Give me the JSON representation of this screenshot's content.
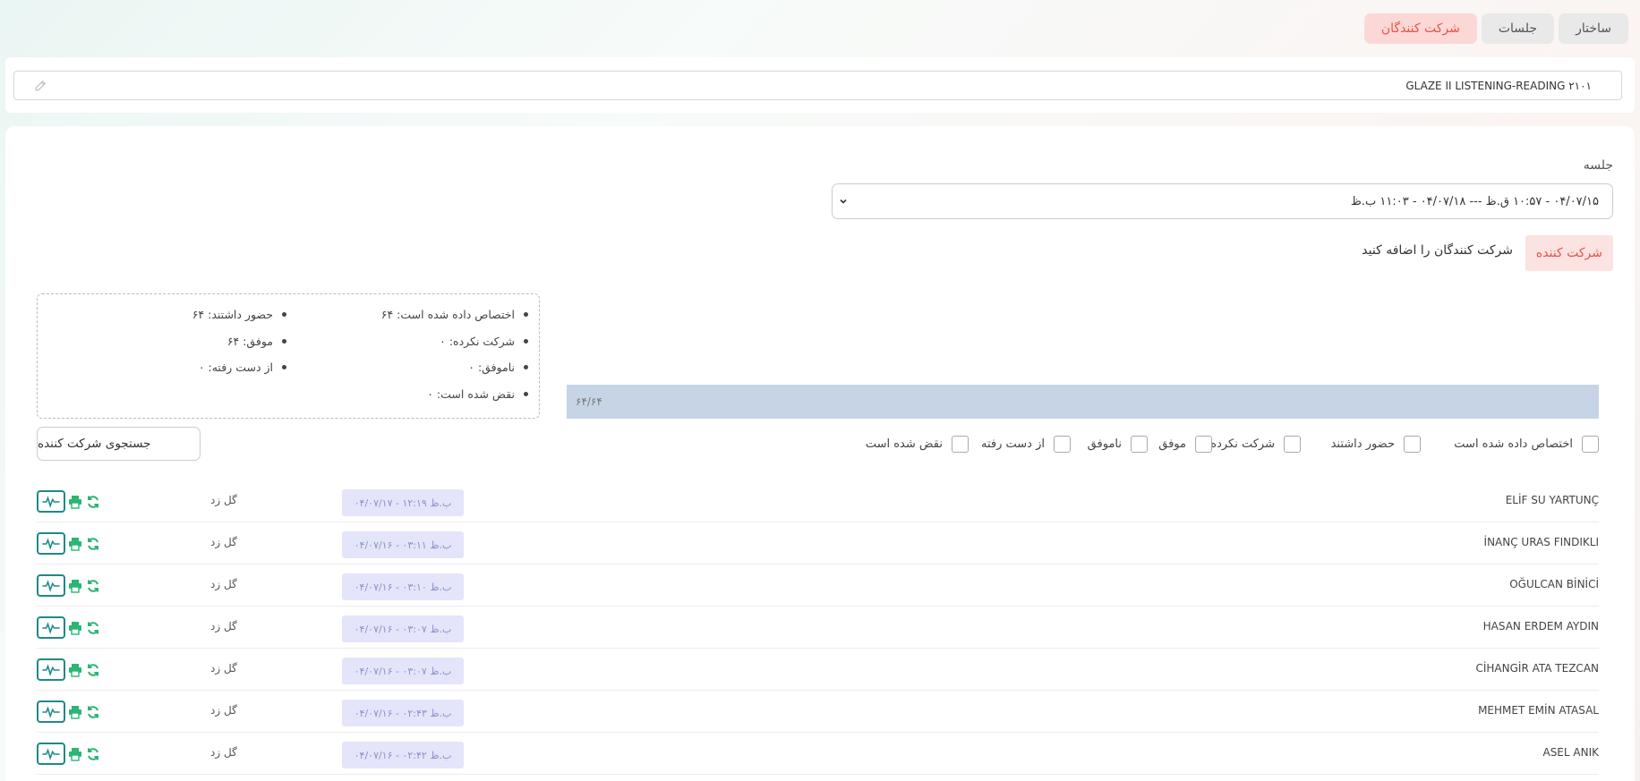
{
  "tabs": [
    {
      "label": "ساختار",
      "active": false
    },
    {
      "label": "جلسات",
      "active": false
    },
    {
      "label": "شرکت کنندگان",
      "active": true
    }
  ],
  "course_title": "GLAZE II LISTENING-READING ۲۱۰۱",
  "session": {
    "label": "جلسه",
    "selected": "۰۴/۰۷/۱۵ - ۱۰:۵۷ ق.ظ --- ۰۴/۰۷/۱۸ - ۱۱:۰۳ ب.ظ"
  },
  "participant_tab": "شرکت کننده",
  "add_text": "شرکت کنندگان را اضافه کنید",
  "stats": {
    "assigned": "اختصاص داده شده است: ۶۴",
    "attended": "حضور داشتند: ۶۴",
    "not_attended": "شرکت نکرده: ۰",
    "passed": "موفق: ۶۴",
    "failed": "ناموفق: ۰",
    "lost": "از دست رفته: ۰",
    "violated": "نقض شده است: ۰"
  },
  "progress": {
    "text": "۶۴/۶۴",
    "fraction": 1.0
  },
  "search_label": "جستجوی شرکت کننده",
  "filters": [
    "اختصاص داده شده است",
    "حضور داشتند",
    "شرکت نکرده",
    "موفق",
    "ناموفق",
    "از دست رفته",
    "نقض شده است"
  ],
  "rows": [
    {
      "name": "ELİF SU YARTUNÇ",
      "timestamp": "۰۴/۰۷/۱۷ - ۱۲:۱۹ ب.ظ",
      "status": "گل زد"
    },
    {
      "name": "İNANÇ URAS FINDIKLI",
      "timestamp": "۰۴/۰۷/۱۶ - ۰۳:۱۱ ب.ظ",
      "status": "گل زد"
    },
    {
      "name": "OĞULCAN BİNİCİ",
      "timestamp": "۰۴/۰۷/۱۶ - ۰۳:۱۰ ب.ظ",
      "status": "گل زد"
    },
    {
      "name": "HASAN ERDEM AYDIN",
      "timestamp": "۰۴/۰۷/۱۶ - ۰۳:۰۷ ب.ظ",
      "status": "گل زد"
    },
    {
      "name": "CİHANGİR ATA TEZCAN",
      "timestamp": "۰۴/۰۷/۱۶ - ۰۳:۰۷ ب.ظ",
      "status": "گل زد"
    },
    {
      "name": "MEHMET EMİN ATASAL",
      "timestamp": "۰۴/۰۷/۱۶ - ۰۲:۴۳ ب.ظ",
      "status": "گل زد"
    },
    {
      "name": "ASEL ANIK",
      "timestamp": "۰۴/۰۷/۱۶ - ۰۲:۴۲ ب.ظ",
      "status": "گل زد"
    }
  ],
  "icons": {
    "pulse": "activity-icon",
    "print": "print-icon",
    "refresh": "refresh-icon",
    "edit": "pencil-icon",
    "dropdown": "chevron-down-icon"
  },
  "colors": {
    "accent": "#e8534a",
    "accent_bg": "#fbd8d6",
    "action_teal": "#1f8a86",
    "action_green": "#2ab673",
    "progress_bg": "#c6d4e6",
    "timestamp_bg": "#e4e4fa"
  }
}
